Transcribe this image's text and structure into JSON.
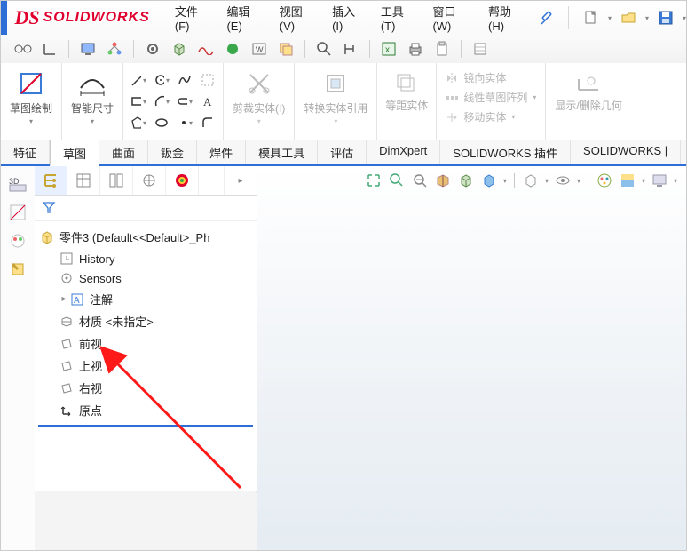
{
  "app": {
    "name": "SOLIDWORKS"
  },
  "menu": {
    "file": "文件(F)",
    "edit": "编辑(E)",
    "view": "视图(V)",
    "insert": "插入(I)",
    "tools": "工具(T)",
    "window": "窗口(W)",
    "help": "帮助(H)"
  },
  "ribbon": {
    "sketch_draw": "草图绘制",
    "smart_dim": "智能尺寸",
    "trim": "剪裁实体(I)",
    "convert": "转换实体引用",
    "offset": "等距实体",
    "mirror": "镜向实体",
    "linear_pat": "线性草图阵列",
    "move": "移动实体",
    "show_hide": "显示/删除几何"
  },
  "tabs": {
    "feature": "特征",
    "sketch": "草图",
    "surface": "曲面",
    "sheet": "钣金",
    "weld": "焊件",
    "mold": "模具工具",
    "evaluate": "评估",
    "dimxpert": "DimXpert",
    "swaddins": "SOLIDWORKS 插件",
    "swextra": "SOLIDWORKS |"
  },
  "tree": {
    "root": "零件3  (Default<<Default>_Ph",
    "history": "History",
    "sensors": "Sensors",
    "annot": "注解",
    "material": "材质 <未指定>",
    "front": "前视",
    "top": "上视",
    "right": "右视",
    "origin": "原点"
  },
  "icons": {
    "pin": "pin",
    "newdoc": "new",
    "opendoc": "open",
    "save": "save"
  }
}
